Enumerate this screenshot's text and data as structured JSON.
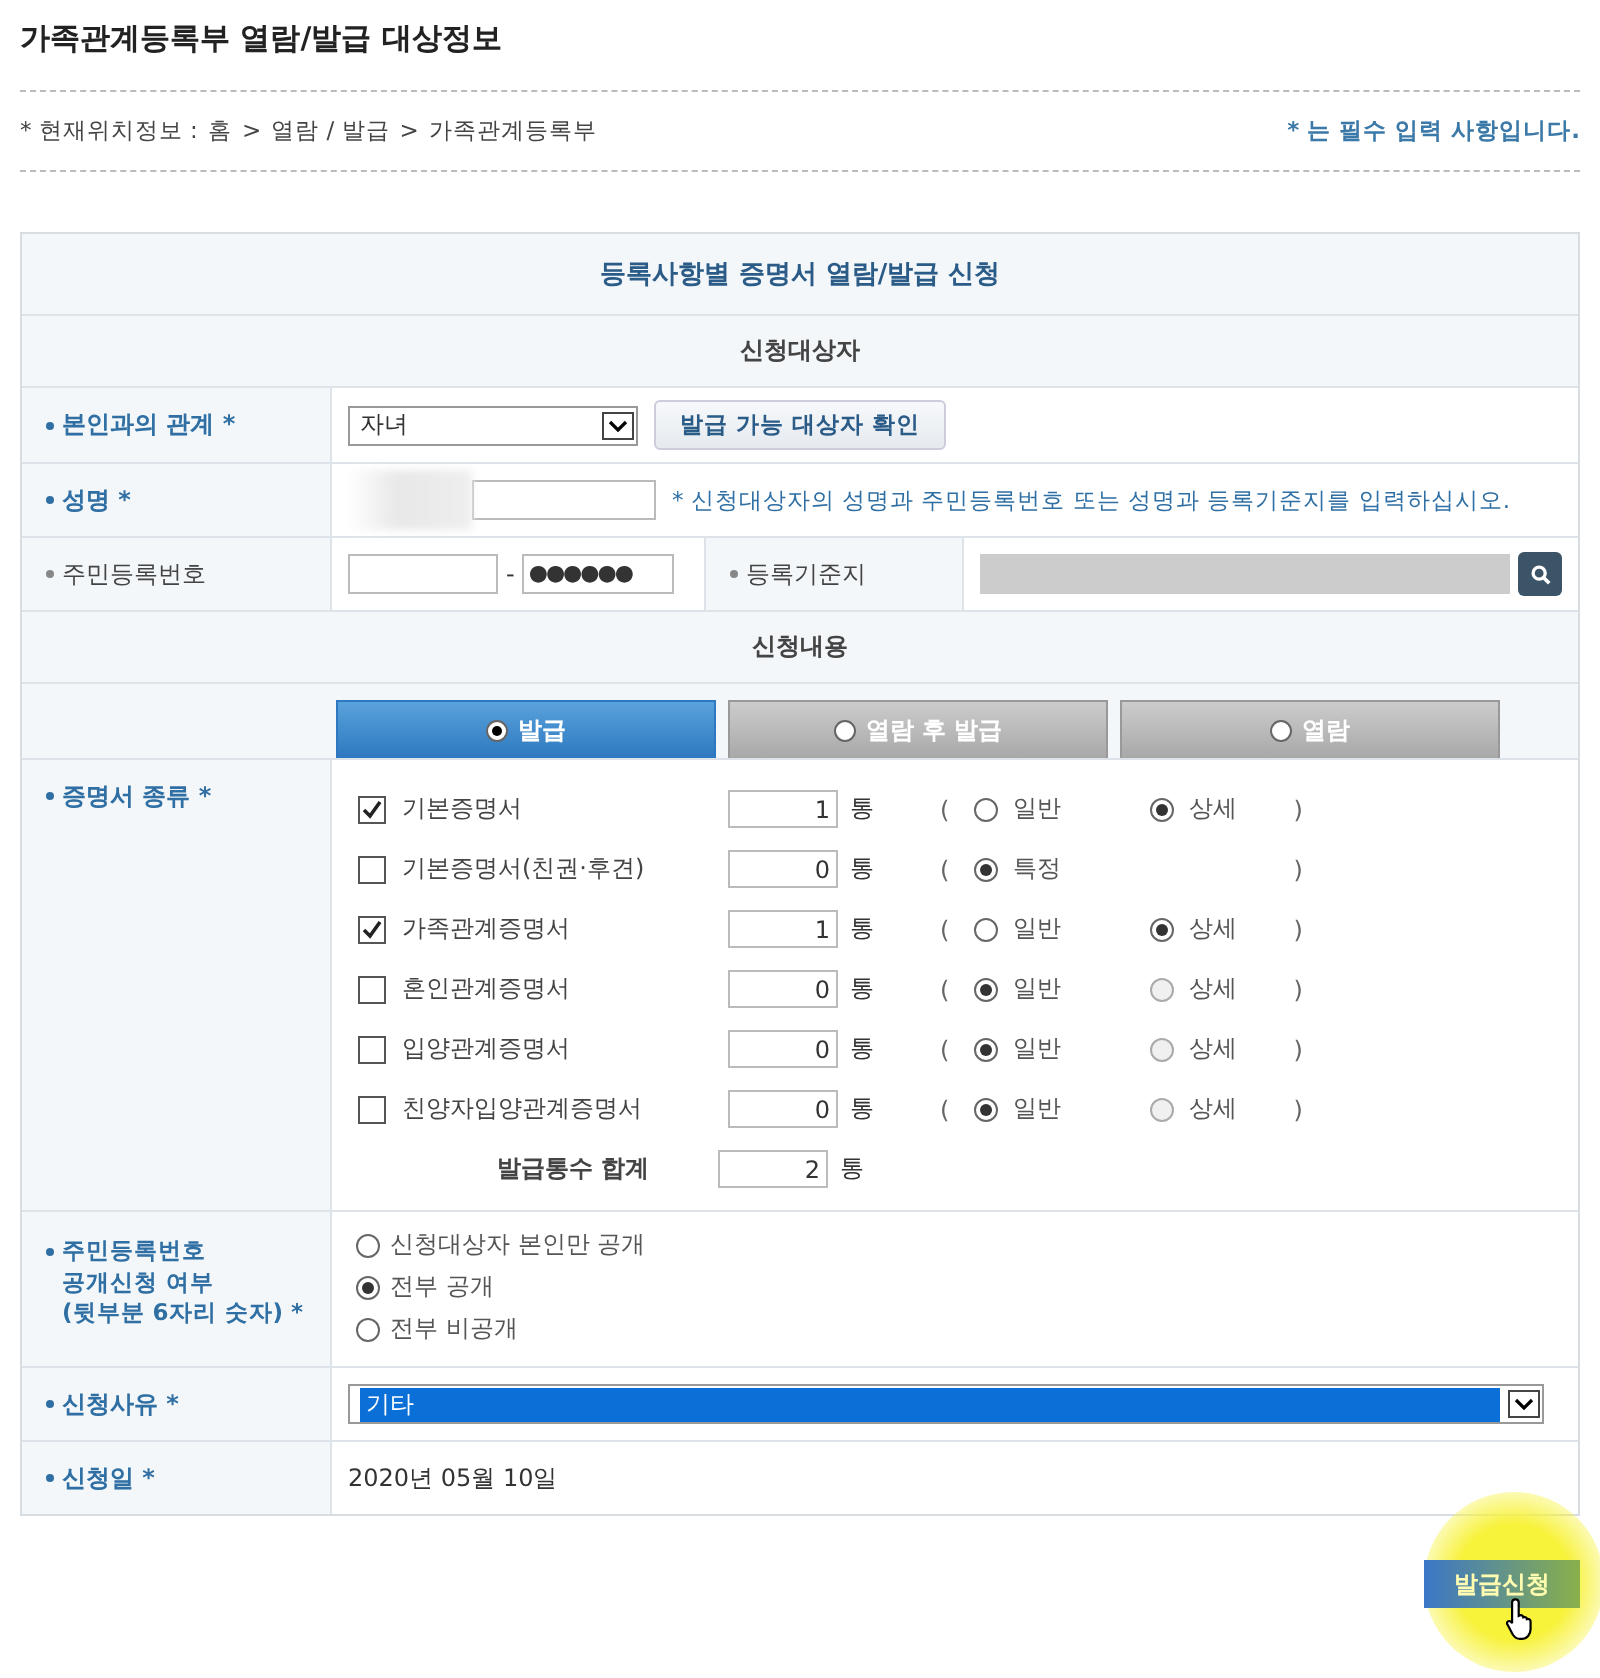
{
  "page_title": "가족관계등록부 열람/발급 대상정보",
  "breadcrumb": {
    "label": "* 현재위치정보 :",
    "items": [
      "홈",
      "열람 / 발급",
      "가족관계등록부"
    ],
    "separator": ">"
  },
  "required_note": "* 는 필수 입력 사항입니다.",
  "form": {
    "title": "등록사항별 증명서 열람/발급 신청",
    "section_target": "신청대상자",
    "relation": {
      "label": "본인과의 관계 *",
      "required": true,
      "value": "자녀",
      "button": "발급 가능 대상자 확인"
    },
    "name": {
      "label": "성명 *",
      "required": true,
      "hint": "* 신청대상자의 성명과 주민등록번호 또는 성명과 등록기준지를 입력하십시오."
    },
    "resident_number": {
      "label": "주민등록번호",
      "required": false,
      "dash": "-",
      "masked": "●●●●●●"
    },
    "registry_base": {
      "label": "등록기준지",
      "required": false
    },
    "section_content": "신청내용",
    "tabs": [
      {
        "label": "발급",
        "selected": true
      },
      {
        "label": "열람 후 발급",
        "selected": false
      },
      {
        "label": "열람",
        "selected": false
      }
    ],
    "certificates": {
      "label": "증명서 종류 *",
      "required": true,
      "rows": [
        {
          "name": "기본증명서",
          "checked": true,
          "count": "1",
          "unit": "통",
          "open": "(",
          "close": ")",
          "options": [
            {
              "label": "일반",
              "selected": false
            },
            {
              "label": "상세",
              "selected": true
            }
          ]
        },
        {
          "name": "기본증명서(친권·후견)",
          "checked": false,
          "count": "0",
          "unit": "통",
          "open": "(",
          "close": ")",
          "options": [
            {
              "label": "특정",
              "selected": true
            }
          ]
        },
        {
          "name": "가족관계증명서",
          "checked": true,
          "count": "1",
          "unit": "통",
          "open": "(",
          "close": ")",
          "options": [
            {
              "label": "일반",
              "selected": false
            },
            {
              "label": "상세",
              "selected": true
            }
          ]
        },
        {
          "name": "혼인관계증명서",
          "checked": false,
          "count": "0",
          "unit": "통",
          "open": "(",
          "close": ")",
          "options": [
            {
              "label": "일반",
              "selected": true
            },
            {
              "label": "상세",
              "selected": false
            }
          ]
        },
        {
          "name": "입양관계증명서",
          "checked": false,
          "count": "0",
          "unit": "통",
          "open": "(",
          "close": ")",
          "options": [
            {
              "label": "일반",
              "selected": true
            },
            {
              "label": "상세",
              "selected": false
            }
          ]
        },
        {
          "name": "친양자입양관계증명서",
          "checked": false,
          "count": "0",
          "unit": "통",
          "open": "(",
          "close": ")",
          "options": [
            {
              "label": "일반",
              "selected": true
            },
            {
              "label": "상세",
              "selected": false
            }
          ]
        }
      ],
      "total": {
        "label": "발급통수 합계",
        "count": "2",
        "unit": "통"
      }
    },
    "disclosure": {
      "label_lines": [
        "주민등록번호",
        "공개신청 여부",
        "(뒷부분 6자리 숫자) *"
      ],
      "required": true,
      "options": [
        {
          "label": "신청대상자 본인만 공개",
          "selected": false
        },
        {
          "label": "전부 공개",
          "selected": true
        },
        {
          "label": "전부 비공개",
          "selected": false
        }
      ]
    },
    "reason": {
      "label": "신청사유 *",
      "required": true,
      "value": "기타",
      "highlighted": true
    },
    "date": {
      "label": "신청일 *",
      "required": true,
      "value": "2020년 05월 10일"
    }
  },
  "submit": "발급신청"
}
